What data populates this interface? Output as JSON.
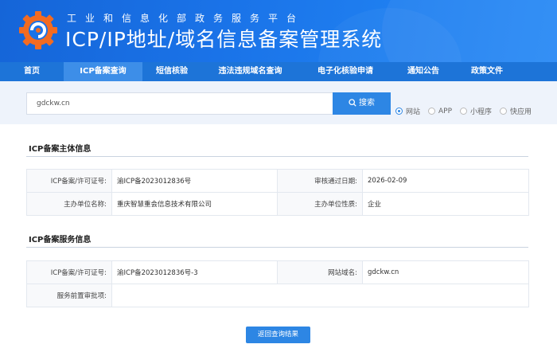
{
  "header": {
    "subtitle": "工业和信息化部政务服务平台",
    "title": "ICP/IP地址/域名信息备案管理系统"
  },
  "nav": {
    "items": [
      {
        "label": "首页",
        "active": false
      },
      {
        "label": "ICP备案查询",
        "active": true
      },
      {
        "label": "短信核验",
        "active": false
      },
      {
        "label": "违法违规域名查询",
        "active": false
      },
      {
        "label": "电子化核验申请",
        "active": false
      },
      {
        "label": "通知公告",
        "active": false
      },
      {
        "label": "政策文件",
        "active": false
      }
    ]
  },
  "search": {
    "value": "gdckw.cn",
    "button_label": "搜索",
    "options": [
      {
        "label": "网站",
        "checked": true
      },
      {
        "label": "APP",
        "checked": false
      },
      {
        "label": "小程序",
        "checked": false
      },
      {
        "label": "快应用",
        "checked": false
      }
    ]
  },
  "subject_info": {
    "title": "ICP备案主体信息",
    "license_label": "ICP备案/许可证号:",
    "license_value": "渝ICP备2023012836号",
    "approve_date_label": "审核通过日期:",
    "approve_date_value": "2026-02-09",
    "org_label": "主办单位名称:",
    "org_value": "重庆智慧重会信息技术有限公司",
    "org_type_label": "主办单位性质:",
    "org_type_value": "企业"
  },
  "service_info": {
    "title": "ICP备案服务信息",
    "license_label": "ICP备案/许可证号:",
    "license_value": "渝ICP备2023012836号-3",
    "domain_label": "网站域名:",
    "domain_value": "gdckw.cn",
    "prereview_label": "服务前置审批项:",
    "prereview_value": ""
  },
  "back_button_label": "返回查询结果",
  "colors": {
    "primary": "#2d86e4",
    "banner": "#1a73e8",
    "nav": "#1d74d8",
    "logo_orange": "#f36b21"
  }
}
